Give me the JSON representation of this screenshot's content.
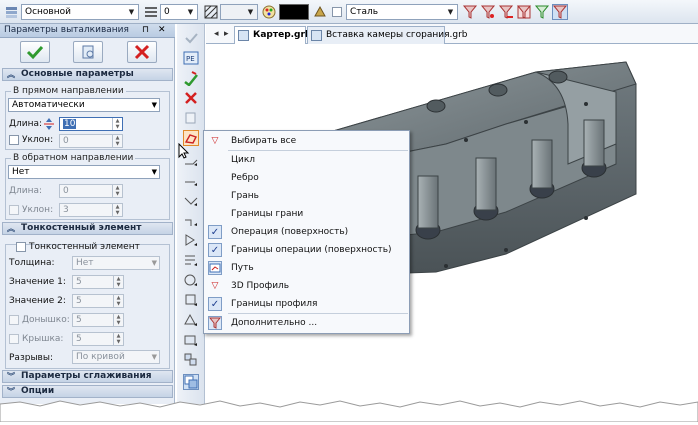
{
  "toolbar": {
    "layer_combo": "Основной",
    "line_count": "0",
    "material_combo": "Сталь"
  },
  "panel": {
    "title": "Параметры выталкивания",
    "pin_glyph": "⊓",
    "close_glyph": "✕",
    "sections": {
      "main": "Основные параметры",
      "thin": "Тонкостенный элемент",
      "smooth": "Параметры сглаживания",
      "options": "Опции"
    },
    "forward": {
      "caption": "В прямом направлении",
      "mode": "Автоматически",
      "length_label": "Длина:",
      "length_value": "10",
      "taper_label": "Уклон:",
      "taper_value": "0"
    },
    "backward": {
      "caption": "В обратном направлении",
      "mode": "Нет",
      "length_label": "Длина:",
      "length_value": "0",
      "taper_label": "Уклон:",
      "taper_value": "3"
    },
    "thin": {
      "checkbox_label": "Тонкостенный элемент",
      "thickness_label": "Толщина:",
      "thickness_value": "Нет",
      "value1_label": "Значение 1:",
      "value1": "5",
      "value2_label": "Значение 2:",
      "value2": "5",
      "bottom_label": "Донышко:",
      "bottom_value": "5",
      "lid_label": "Крышка:",
      "lid_value": "5",
      "gaps_label": "Разрывы:",
      "gaps_value": "По кривой"
    }
  },
  "tabs": [
    {
      "label": "Картер.grb"
    },
    {
      "label": "Вставка камеры сгорания.grb"
    }
  ],
  "menu": {
    "items": [
      {
        "label": "Выбирать все"
      },
      {
        "label": "Цикл"
      },
      {
        "label": "Ребро"
      },
      {
        "label": "Грань"
      },
      {
        "label": "Границы грани"
      },
      {
        "label": "Операция (поверхность)"
      },
      {
        "label": "Границы операции (поверхность)"
      },
      {
        "label": "Путь"
      },
      {
        "label": "3D Профиль"
      },
      {
        "label": "Границы профиля"
      },
      {
        "label": "Дополнительно ..."
      }
    ]
  },
  "colors": {
    "accent": "#3f6fb4",
    "ok_green": "#2f9a2f",
    "cancel_red": "#d42020",
    "model_gray": "#6f7a7f"
  }
}
